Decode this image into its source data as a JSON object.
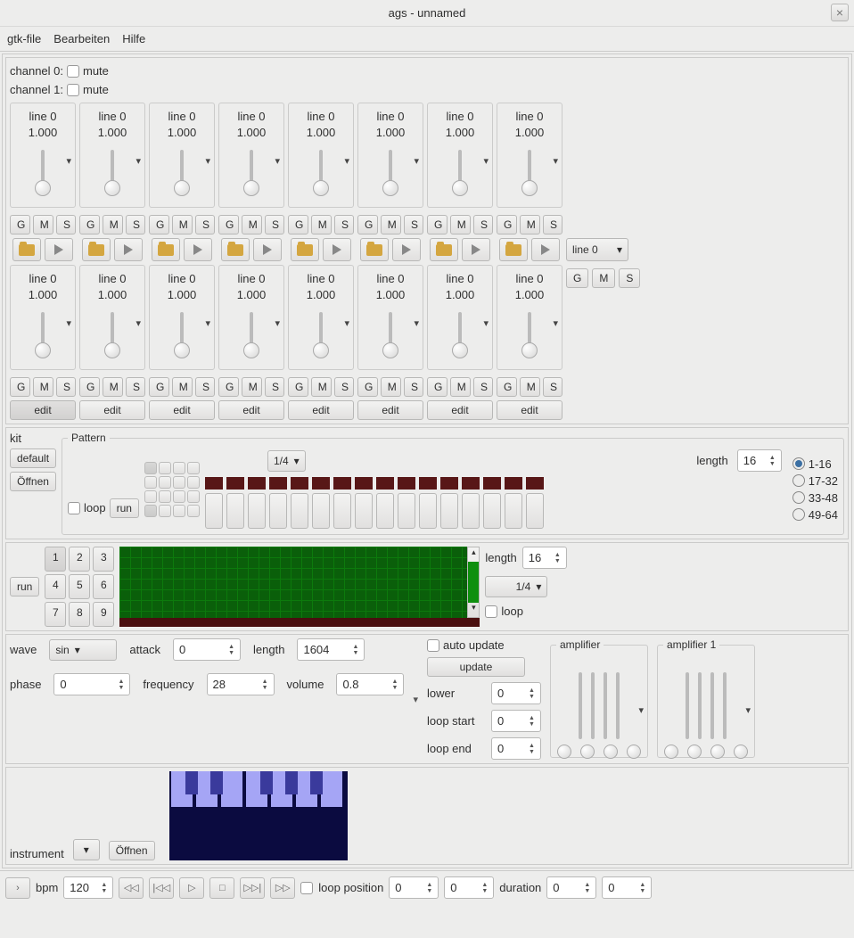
{
  "window": {
    "title": "ags - unnamed"
  },
  "menu": {
    "file": "gtk-file",
    "edit": "Bearbeiten",
    "help": "Hilfe"
  },
  "channels": [
    {
      "label": "channel 0:",
      "mute": "mute"
    },
    {
      "label": "channel 1:",
      "mute": "mute"
    }
  ],
  "mixer": {
    "line_label": "line 0",
    "value": "1.000",
    "gms": {
      "g": "G",
      "m": "M",
      "s": "S"
    },
    "edit": "edit",
    "line0_select": "line 0"
  },
  "kit": {
    "label": "kit",
    "default": "default",
    "open": "Öffnen"
  },
  "pattern": {
    "title": "Pattern",
    "loop": "loop",
    "run": "run",
    "quant": "1/4",
    "length_label": "length",
    "length_val": "16",
    "ranges": [
      "1-16",
      "17-32",
      "33-48",
      "49-64"
    ]
  },
  "sequencer": {
    "run": "run",
    "nums": [
      "1",
      "2",
      "3",
      "4",
      "5",
      "6",
      "7",
      "8",
      "9"
    ],
    "length_label": "length",
    "length_val": "16",
    "quant": "1/4",
    "loop": "loop"
  },
  "oscillator": {
    "wave_label": "wave",
    "wave_val": "sin",
    "attack_label": "attack",
    "attack_val": "0",
    "length_label": "length",
    "length_val": "1604",
    "phase_label": "phase",
    "phase_val": "0",
    "freq_label": "frequency",
    "freq_val": "28",
    "vol_label": "volume",
    "vol_val": "0.8",
    "auto_update": "auto update",
    "update": "update",
    "lower_label": "lower",
    "lower_val": "0",
    "loop_start_label": "loop start",
    "loop_start_val": "0",
    "loop_end_label": "loop end",
    "loop_end_val": "0",
    "amp": "amplifier",
    "amp1": "amplifier 1"
  },
  "instrument": {
    "label": "instrument",
    "open": "Öffnen"
  },
  "transport": {
    "bpm_label": "bpm",
    "bpm_val": "120",
    "loop_pos": "loop position",
    "loop_pos_val": "0",
    "loop_pos_val2": "0",
    "duration": "duration",
    "dur_val": "0",
    "dur_val2": "0"
  }
}
